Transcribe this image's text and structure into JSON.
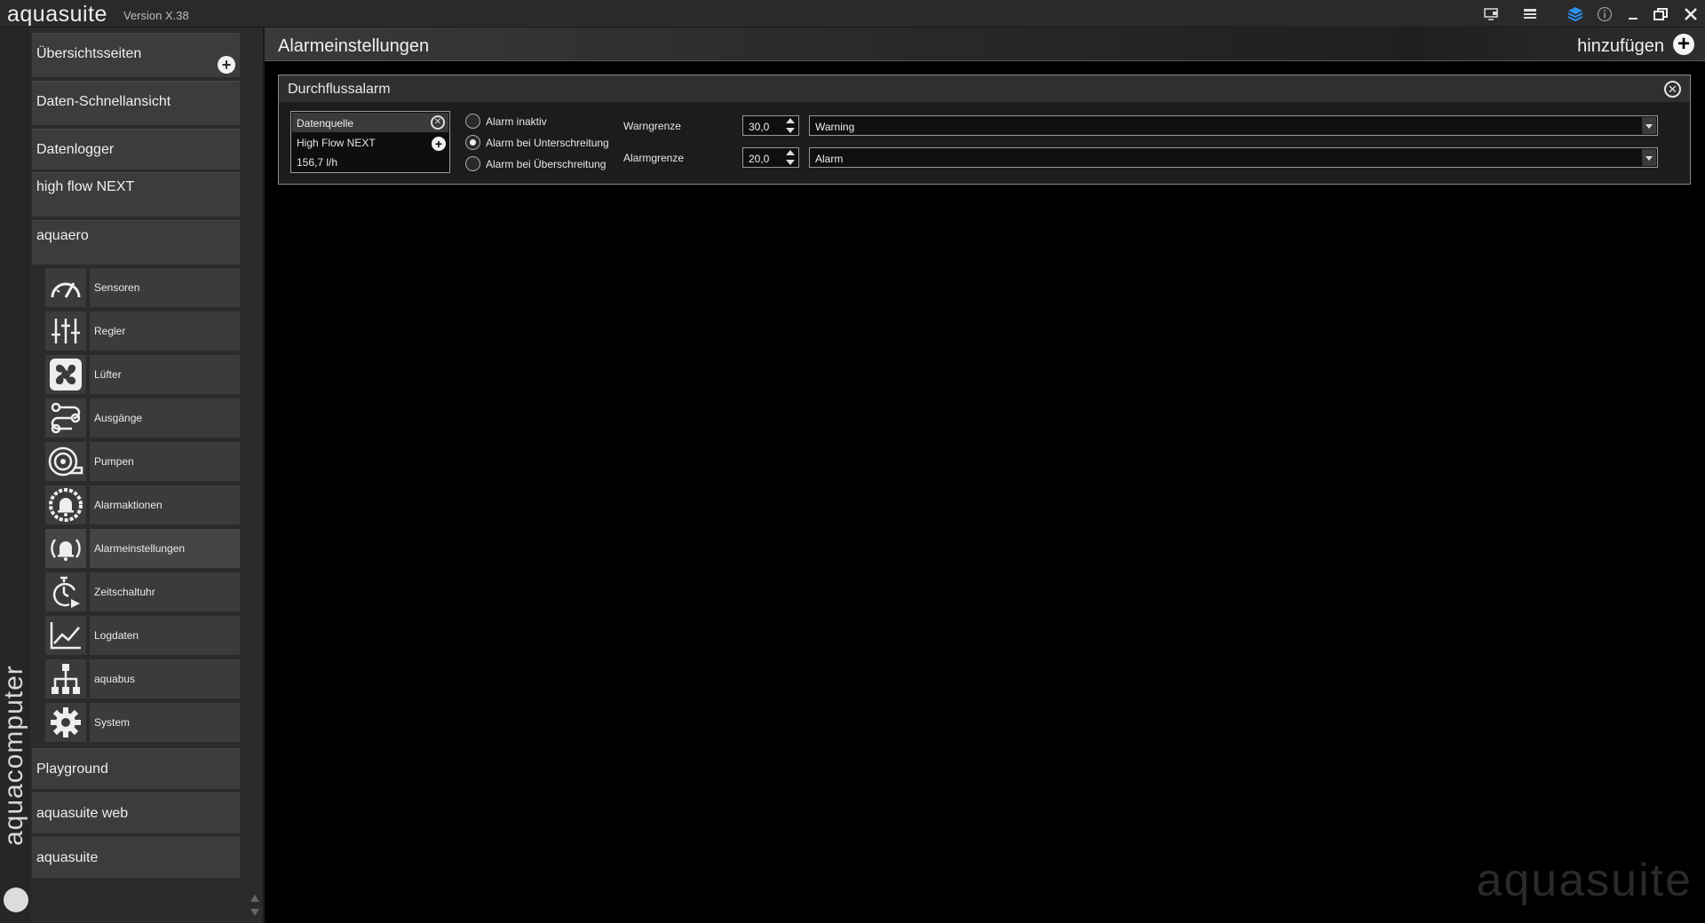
{
  "titlebar": {
    "app_name": "aquasuite",
    "version": "Version X.38",
    "icons": [
      "display-icon",
      "list-icon",
      "layers-icon",
      "info-icon",
      "minimize-icon",
      "restore-icon",
      "close-icon"
    ]
  },
  "sidebar": {
    "brand": "aquacomputer",
    "top_items": [
      {
        "label": "Übersichtsseiten"
      },
      {
        "label": "Daten-Schnellansicht"
      },
      {
        "label": "Datenlogger"
      },
      {
        "label": "high flow NEXT"
      },
      {
        "label": "aquaero"
      }
    ],
    "sub_items": [
      {
        "label": "Sensoren",
        "icon": "gauge-icon"
      },
      {
        "label": "Regler",
        "icon": "sliders-icon"
      },
      {
        "label": "Lüfter",
        "icon": "fan-icon"
      },
      {
        "label": "Ausgänge",
        "icon": "outputs-icon"
      },
      {
        "label": "Pumpen",
        "icon": "pump-icon"
      },
      {
        "label": "Alarmaktionen",
        "icon": "alarm-bell-icon"
      },
      {
        "label": "Alarmeinstellungen",
        "icon": "alarm-settings-icon"
      },
      {
        "label": "Zeitschaltuhr",
        "icon": "timer-icon"
      },
      {
        "label": "Logdaten",
        "icon": "chart-icon"
      },
      {
        "label": "aquabus",
        "icon": "network-icon"
      },
      {
        "label": "System",
        "icon": "gear-icon"
      }
    ],
    "bottom_items": [
      {
        "label": "Playground"
      },
      {
        "label": "aquasuite web"
      },
      {
        "label": "aquasuite"
      }
    ]
  },
  "main": {
    "title": "Alarmeinstellungen",
    "add_label": "hinzufügen",
    "panel": {
      "title": "Durchflussalarm",
      "source": {
        "header": "Datenquelle",
        "device": "High Flow NEXT",
        "value": "156,7 l/h"
      },
      "radios": [
        {
          "label": "Alarm inaktiv",
          "checked": false
        },
        {
          "label": "Alarm bei Unterschreitung",
          "checked": true
        },
        {
          "label": "Alarm bei Überschreitung",
          "checked": false
        }
      ],
      "warn": {
        "label": "Warngrenze",
        "value": "30,0",
        "action": "Warning"
      },
      "alarm": {
        "label": "Alarmgrenze",
        "value": "20,0",
        "action": "Alarm"
      }
    },
    "watermark": "aquasuite"
  }
}
